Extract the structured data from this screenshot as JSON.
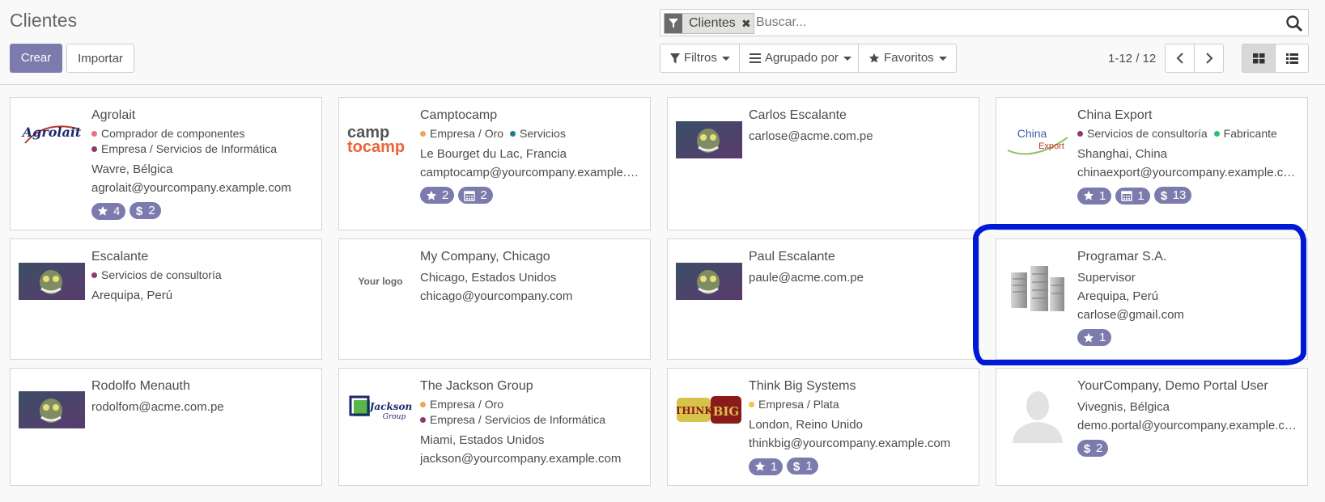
{
  "header": {
    "title": "Clientes",
    "create_label": "Crear",
    "import_label": "Importar"
  },
  "search": {
    "facet_label": "Clientes",
    "placeholder": "Buscar..."
  },
  "filters": {
    "filters_label": "Filtros",
    "groupby_label": "Agrupado por",
    "favorites_label": "Favoritos"
  },
  "pager": {
    "value": "1-12 / 12"
  },
  "colors": {
    "accent": "#7c7bad",
    "annotation": "#0019d6",
    "tag_red": "#e8737e",
    "tag_purple": "#8b3a6b",
    "tag_orange": "#f0a35a",
    "tag_teal": "#1f7d8c",
    "tag_green": "#2ebf6f",
    "tag_yellow": "#f6c342"
  },
  "cards": [
    {
      "name": "Agrolait",
      "logo": "agrolait-logo",
      "logo_text": "Agrolait",
      "tag_rows": [
        [
          {
            "label": "Comprador de componentes",
            "color": "#e8737e"
          }
        ],
        [
          {
            "label": "Empresa / Servicios de Informática",
            "color": "#8b3a6b"
          }
        ]
      ],
      "lines": [
        "Wavre, Bélgica",
        "agrolait@yourcompany.example.com"
      ],
      "badges": [
        {
          "icon": "star-icon",
          "value": "4"
        },
        {
          "icon": "dollar-icon",
          "value": "2"
        }
      ]
    },
    {
      "name": "Camptocamp",
      "logo": "camptocamp-logo",
      "logo_text": [
        "camp",
        "tocamp"
      ],
      "tag_rows": [
        [
          {
            "label": "Empresa / Oro",
            "color": "#f0a35a"
          },
          {
            "label": "Servicios",
            "color": "#1f7d8c"
          }
        ]
      ],
      "lines": [
        "Le Bourget du Lac, Francia",
        "camptocamp@yourcompany.example.com"
      ],
      "badges": [
        {
          "icon": "star-icon",
          "value": "2"
        },
        {
          "icon": "calendar-icon",
          "value": "2"
        }
      ]
    },
    {
      "name": "Carlos Escalante",
      "logo": "avatar-photo",
      "tag_rows": [],
      "lines": [
        "carlose@acme.com.pe"
      ],
      "badges": []
    },
    {
      "name": "China Export",
      "logo": "china-export-logo",
      "logo_text": [
        "China",
        "Export"
      ],
      "tag_rows": [
        [
          {
            "label": "Servicios de consultoría",
            "color": "#8b3a6b"
          },
          {
            "label": "Fabricante",
            "color": "#2ebf6f"
          }
        ]
      ],
      "lines": [
        "Shanghai, China",
        "chinaexport@yourcompany.example.com"
      ],
      "badges": [
        {
          "icon": "star-icon",
          "value": "1"
        },
        {
          "icon": "calendar-icon",
          "value": "1"
        },
        {
          "icon": "dollar-icon",
          "value": "13"
        }
      ]
    },
    {
      "name": "Escalante",
      "logo": "avatar-photo",
      "tag_rows": [
        [
          {
            "label": "Servicios de consultoría",
            "color": "#8b3a6b"
          }
        ]
      ],
      "lines": [
        "Arequipa, Perú"
      ],
      "badges": []
    },
    {
      "name": "My Company, Chicago",
      "logo": "your-logo",
      "logo_text": "Your logo",
      "tag_rows": [],
      "lines": [
        "Chicago, Estados Unidos",
        "chicago@yourcompany.com"
      ],
      "badges": []
    },
    {
      "name": "Paul Escalante",
      "logo": "avatar-photo",
      "tag_rows": [],
      "lines": [
        "paule@acme.com.pe"
      ],
      "badges": []
    },
    {
      "name": "Programar S.A.",
      "logo": "company-buildings-icon",
      "tag_rows": [],
      "lines": [
        "Supervisor",
        "Arequipa, Perú",
        "carlose@gmail.com"
      ],
      "badges": [
        {
          "icon": "star-icon",
          "value": "1"
        }
      ]
    },
    {
      "name": "Rodolfo Menauth",
      "logo": "avatar-photo",
      "tag_rows": [],
      "lines": [
        "rodolfom@acme.com.pe"
      ],
      "badges": []
    },
    {
      "name": "The Jackson Group",
      "logo": "jackson-logo",
      "logo_text": [
        "Jackson",
        "Group"
      ],
      "tag_rows": [
        [
          {
            "label": "Empresa / Oro",
            "color": "#f0a35a"
          }
        ],
        [
          {
            "label": "Empresa / Servicios de Informática",
            "color": "#8b3a6b"
          }
        ]
      ],
      "lines": [
        "Miami, Estados Unidos",
        "jackson@yourcompany.example.com"
      ],
      "badges": []
    },
    {
      "name": "Think Big Systems",
      "logo": "thinkbig-logo",
      "logo_text": [
        "THINK",
        "BIG"
      ],
      "tag_rows": [
        [
          {
            "label": "Empresa / Plata",
            "color": "#f6c342"
          }
        ]
      ],
      "lines": [
        "London, Reino Unido",
        "thinkbig@yourcompany.example.com"
      ],
      "badges": [
        {
          "icon": "star-icon",
          "value": "1"
        },
        {
          "icon": "dollar-icon",
          "value": "1"
        }
      ]
    },
    {
      "name": "YourCompany, Demo Portal User",
      "logo": "default-avatar",
      "tag_rows": [],
      "lines": [
        "Vivegnis, Bélgica",
        "demo.portal@yourcompany.example.com"
      ],
      "badges": [
        {
          "icon": "dollar-icon",
          "value": "2"
        }
      ]
    }
  ]
}
